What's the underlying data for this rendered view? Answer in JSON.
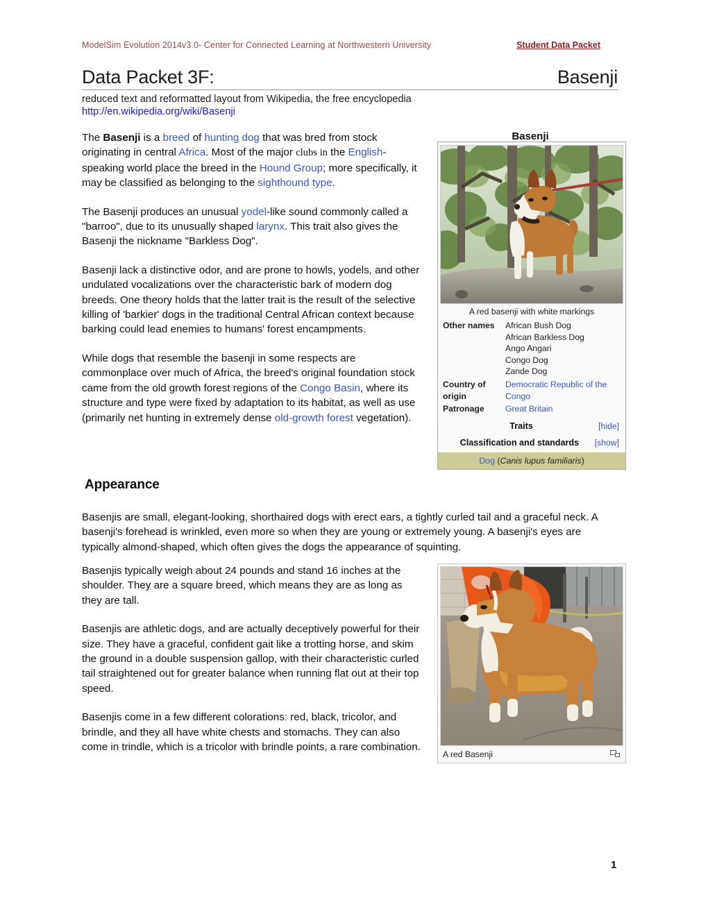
{
  "header": {
    "left": "ModelSim Evolution 2014v3.0- Center for Connected Learning at Northwestern University",
    "right": "Student Data Packet"
  },
  "title": {
    "main": "Data Packet 3F:",
    "right": "Basenji",
    "subtitle": "reduced text and reformatted layout from Wikipedia, the free encyclopedia",
    "url": "http://en.wikipedia.org/wiki/Basenji"
  },
  "body": {
    "p1_a": "The ",
    "p1_basenji": "Basenji",
    "p1_b": " is a ",
    "p1_breed": "breed",
    "p1_c": " of ",
    "p1_hunting": "hunting dog",
    "p1_d": " that was bred from stock originating in central ",
    "p1_africa": "Africa",
    "p1_e": ".  Most of the major ",
    "p1_clubs": "clubs in",
    "p1_f": " the ",
    "p1_english": "English",
    "p1_g": "-speaking world place the breed in the ",
    "p1_hound": "Hound Group",
    "p1_h": "; more specifically, it may be classified as belonging to the ",
    "p1_sight": "sighthound type",
    "p1_i": ".",
    "p2_a": "The Basenji produces an unusual ",
    "p2_yodel": "yodel",
    "p2_b": "-like sound commonly called a \"barroo\", due to its unusually shaped ",
    "p2_larynx": "larynx",
    "p2_c": ".  This trait also gives the Basenji the nickname \"Barkless Dog\".",
    "p3": "Basenji lack a distinctive odor, and are prone to howls, yodels, and other undulated vocalizations over the characteristic bark of modern dog breeds.  One theory holds that the latter trait is the result of the selective killing of 'barkier' dogs in the traditional Central African context because barking could lead enemies to humans' forest encampments.",
    "p4_a": "While dogs that resemble the basenji in some respects are commonplace over much of Africa, the breed's original foundation stock came from the old growth forest regions of the ",
    "p4_congo": "Congo Basin",
    "p4_b": ", where its structure and type were fixed by adaptation to its habitat, as well as use (primarily net hunting in extremely dense ",
    "p4_oldgrowth": "old-growth forest",
    "p4_c": " vegetation)."
  },
  "appearance": {
    "heading": "Appearance",
    "p1": "Basenjis are small, elegant-looking, shorthaired dogs with erect ears, a tightly curled tail and a graceful neck.  A basenji's forehead is wrinkled, even more so when they are young or extremely young.  A basenji's eyes are typically almond-shaped, which often gives the dogs the appearance of squinting.",
    "p2": "Basenjis typically weigh about 24 pounds and stand 16 inches at the shoulder.  They are a square breed, which means they are as long as they are tall.",
    "p3": "Basenjis are athletic dogs, and are actually deceptively powerful for their size.  They have a graceful, confident gait like a trotting horse, and skim the ground in a double suspension gallop, with their characteristic curled tail straightened out for greater balance when running flat out at their top speed.",
    "p4": "Basenjis come in a few different colorations: red, black, tricolor, and brindle, and they all have white chests and stomachs. They can also come in trindle, which is a tricolor with brindle points, a rare combination."
  },
  "infobox": {
    "title": "Basenji",
    "photo_caption": "A red basenji with white markings",
    "rows": [
      {
        "label": "Other names",
        "values": [
          "African Bush Dog",
          "African Barkless Dog",
          "Ango Angari",
          "Congo Dog",
          "Zande Dog"
        ],
        "link": false
      },
      {
        "label": "Country of origin",
        "values": [
          "Democratic Republic of the Congo"
        ],
        "link": true
      },
      {
        "label": "Patronage",
        "values": [
          "Great Britain"
        ],
        "link": true
      }
    ],
    "traits_label": "Traits",
    "traits_toggle": "[hide]",
    "classification_label": "Classification and standards",
    "classification_toggle": "[show]",
    "footer_link": "Dog",
    "footer_species": "Canis lupus familiaris"
  },
  "figure2": {
    "caption": "A red Basenji",
    "enlarge_icon": "enlarge-icon"
  },
  "page_number": "1",
  "colors": {
    "header_left": "#a04a4a",
    "header_right": "#8c1f1f",
    "link_blue": "#3a57c8",
    "url_blue": "#1a1ae0",
    "infobox_bg": "#f9f9f9",
    "infobox_border": "#aaaaaa",
    "footer_bar": "#cdcb97"
  }
}
